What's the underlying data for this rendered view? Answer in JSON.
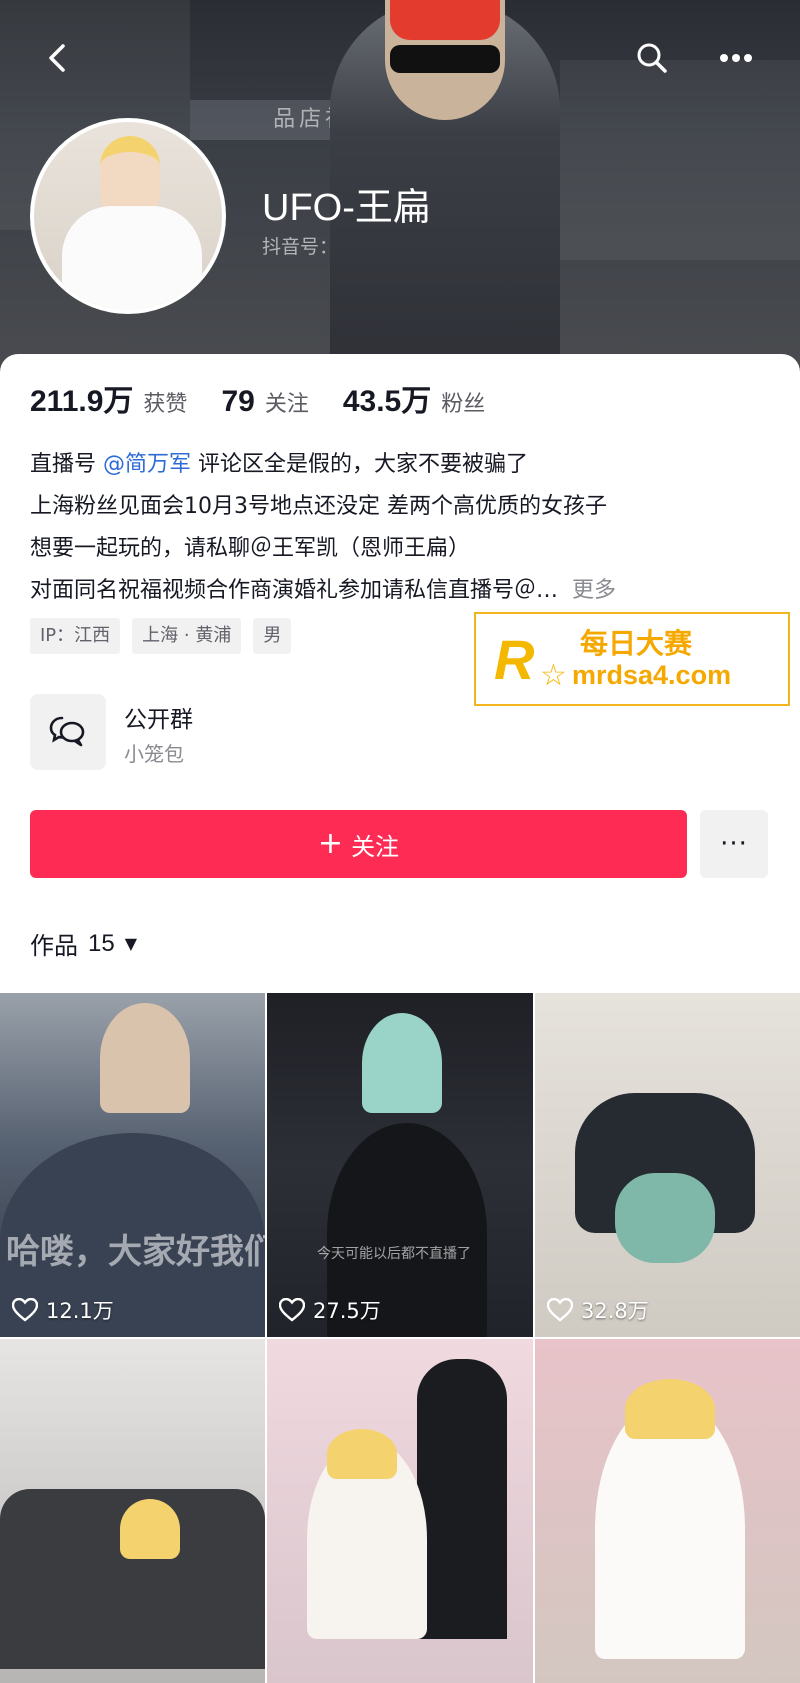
{
  "header": {
    "name": "UFO-王扁",
    "douyin_id_label": "抖音号：",
    "back_icon": "chevron-left-icon",
    "search_icon": "search-icon",
    "more_icon": "more-horizontal-icon",
    "cover_sign": "品店祖元 OSИA"
  },
  "stats": {
    "likes_num": "211.9万",
    "likes_label": "获赞",
    "following_num": "79",
    "following_label": "关注",
    "fans_num": "43.5万",
    "fans_label": "粉丝"
  },
  "bio": {
    "line1_prefix": "直播号 ",
    "line1_mention": "@简万军",
    "line1_suffix": " 评论区全是假的，大家不要被骗了",
    "line2": "上海粉丝见面会10月3号地点还没定 差两个高优质的女孩子",
    "line3": "想要一起玩的，请私聊＠王军凯（恩师王扁）",
    "line4": "对面同名祝福视频合作商演婚礼参加请私信直播号＠…",
    "more": "更多"
  },
  "tags": [
    "IP：江西",
    "上海 · 黄浦",
    "男"
  ],
  "watermark": {
    "logo_letter": "R",
    "logo_small": "每日大赛",
    "name": "每日大赛",
    "url": "mrdsa4.com"
  },
  "group": {
    "title": "公开群",
    "subtitle": "小笼包",
    "icon": "chat-bubbles-icon"
  },
  "actions": {
    "follow_label": "关注",
    "follow_plus": "+",
    "more_label": "···"
  },
  "works": {
    "label": "作品",
    "count": "15",
    "caret": "▼"
  },
  "videos": [
    {
      "likes": "12.1万",
      "overlay": "哈喽，大家好我们"
    },
    {
      "likes": "27.5万",
      "caption": "今天可能以后都不直播了"
    },
    {
      "likes": "32.8万"
    },
    {
      "likes": ""
    },
    {
      "likes": ""
    },
    {
      "likes": ""
    }
  ],
  "colors": {
    "accent": "#fe2c55",
    "mention": "#2d6bd6",
    "watermark": "#f5a800"
  }
}
